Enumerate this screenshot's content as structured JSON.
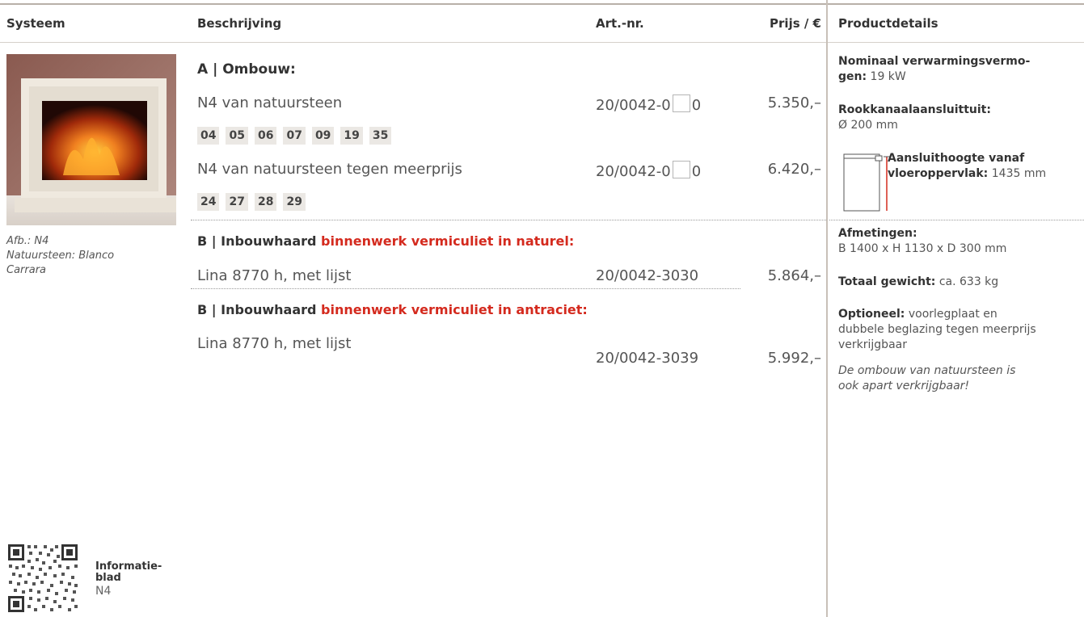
{
  "headers": {
    "system": "Systeem",
    "description": "Beschrijving",
    "article": "Art.-nr.",
    "price": "Prijs / €",
    "details": "Productdetails"
  },
  "image": {
    "caption_line1": "Afb.: N4",
    "caption_line2": "Natuursteen: Blanco",
    "caption_line3": "Carrara"
  },
  "section_a": {
    "title": "A | Ombouw:",
    "row1": {
      "description": "N4 van natuursteen",
      "art_prefix": "20/0042-0",
      "art_suffix": "0",
      "price": "5.350,–"
    },
    "chips1": [
      "04",
      "05",
      "06",
      "07",
      "09",
      "19",
      "35"
    ],
    "row2": {
      "description": "N4 van natuursteen tegen meerprijs",
      "art_prefix": "20/0042-0",
      "art_suffix": "0",
      "price": "6.420,–"
    },
    "chips2": [
      "24",
      "27",
      "28",
      "29"
    ]
  },
  "section_b1": {
    "title_prefix": "B | Inbouwhaard ",
    "title_red": "binnenwerk vermiculiet in naturel:",
    "row": {
      "description": "Lina 8770 h, met lijst",
      "art": "20/0042-3030",
      "price": "5.864,–"
    }
  },
  "section_b2": {
    "title_prefix": "B | Inbouwhaard ",
    "title_red": "binnenwerk vermiculiet in antraciet:",
    "row": {
      "description": "Lina 8770 h, met lijst",
      "art": "20/0042-3039",
      "price": "5.992,–"
    }
  },
  "details": {
    "heating_label_1": "Nominaal verwarmingsvermo-",
    "heating_label_2": "gen:",
    "heating_value": "19 kW",
    "flue_label": "Rookkanaalaansluittuit:",
    "flue_value": "Ø 200 mm",
    "height_label_1": "Aansluithoogte vanaf",
    "height_label_2": "vloeroppervlak:",
    "height_value": "1435 mm",
    "dims_label": "Afmetingen:",
    "dims_value": "B 1400 x H 1130 x D 300 mm",
    "weight_label": "Totaal gewicht:",
    "weight_value": "ca. 633 kg",
    "optional_label": "Optioneel:",
    "optional_value_1": "voorlegplaat en",
    "optional_value_2": "dubbele beglazing tegen meerprijs",
    "optional_value_3": "verkrijgbaar",
    "note_1": "De ombouw van natuursteen is",
    "note_2": "ook apart verkrijgbaar!"
  },
  "info": {
    "label_1": "Informatie-",
    "label_2": "blad",
    "model": "N4"
  },
  "colors": {
    "accent_red": "#d42a1e",
    "chip_bg": "#ebe8e4",
    "rule": "#c8c0b8"
  }
}
